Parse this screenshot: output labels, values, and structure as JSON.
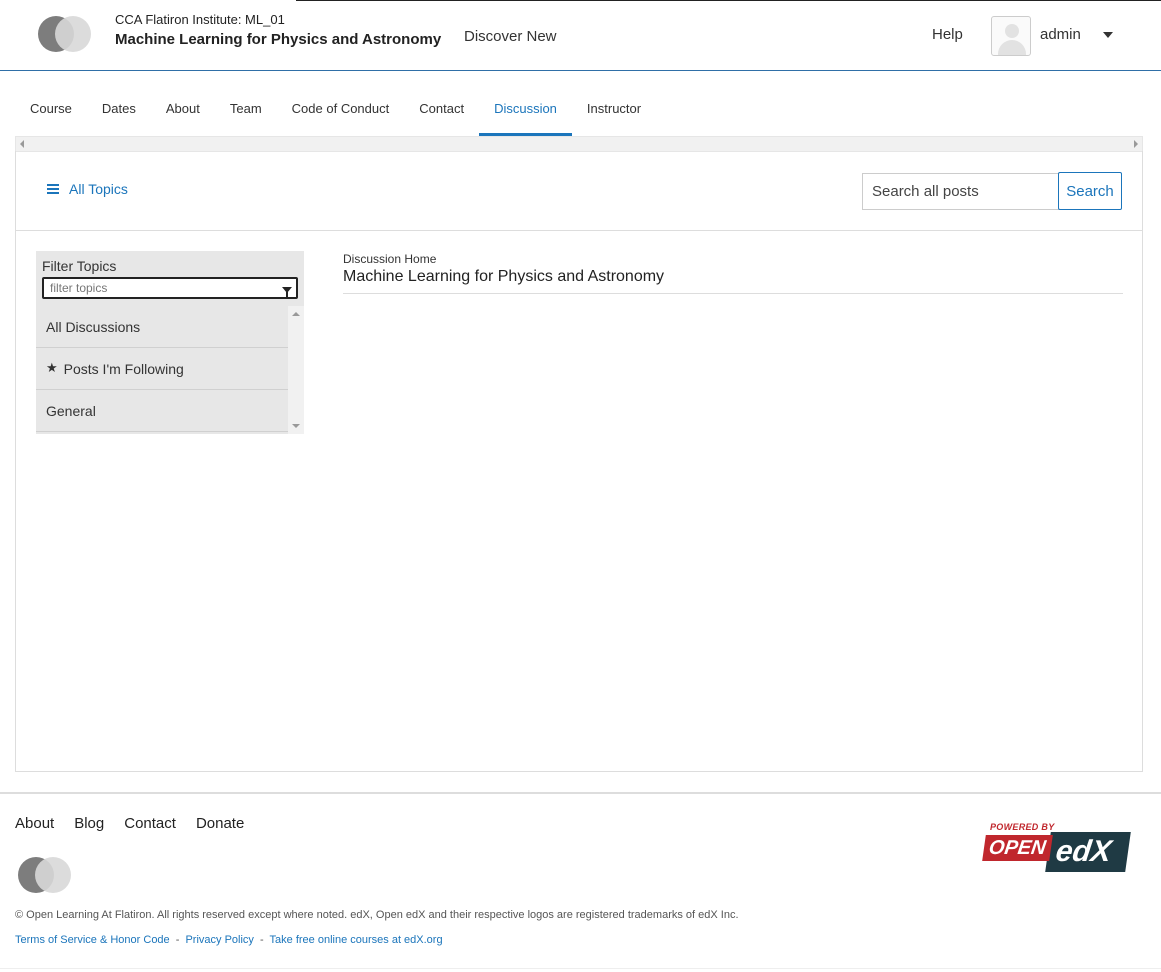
{
  "header": {
    "course_org": "CCA Flatiron Institute: ML_01",
    "course_title": "Machine Learning for Physics and Astronomy",
    "discover": "Discover New",
    "help": "Help",
    "username": "admin"
  },
  "tabs": [
    {
      "label": "Course"
    },
    {
      "label": "Dates"
    },
    {
      "label": "About"
    },
    {
      "label": "Team"
    },
    {
      "label": "Code of Conduct"
    },
    {
      "label": "Contact"
    },
    {
      "label": "Discussion"
    },
    {
      "label": "Instructor"
    }
  ],
  "discussion": {
    "all_topics": "All Topics",
    "search_placeholder": "Search all posts",
    "search_button": "Search",
    "filter_label": "Filter Topics",
    "filter_placeholder": "filter topics",
    "topics": [
      {
        "label": "All Discussions"
      },
      {
        "label": "Posts I'm Following"
      },
      {
        "label": "General"
      }
    ],
    "breadcrumb": "Discussion Home",
    "title": "Machine Learning for Physics and Astronomy"
  },
  "footer": {
    "nav": [
      {
        "label": "About"
      },
      {
        "label": "Blog"
      },
      {
        "label": "Contact"
      },
      {
        "label": "Donate"
      }
    ],
    "copyright": "© Open Learning At Flatiron. All rights reserved except where noted. edX, Open edX and their respective logos are registered trademarks of edX Inc.",
    "legal": [
      {
        "label": "Terms of Service & Honor Code"
      },
      {
        "label": "Privacy Policy"
      },
      {
        "label": "Take free online courses at edX.org"
      }
    ],
    "powered_by": "POWERED BY",
    "powered_open": "OPEN",
    "powered_edx": "edX"
  },
  "colors": {
    "accent": "#1b75bb",
    "sidebar_bg": "#e7e7e7",
    "edx_red": "#c0272d",
    "edx_dark": "#1f3a44"
  }
}
